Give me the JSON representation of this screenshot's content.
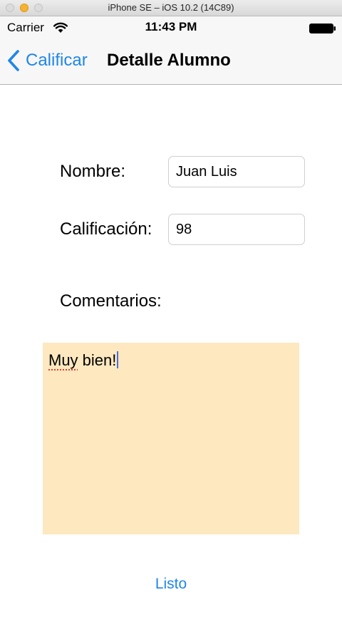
{
  "window": {
    "title": "iPhone SE – iOS 10.2 (14C89)"
  },
  "status_bar": {
    "carrier": "Carrier",
    "time": "11:43 PM",
    "wifi_icon": "wifi-icon",
    "battery_icon": "battery-full-icon"
  },
  "nav_bar": {
    "back_label": "Calificar",
    "back_icon": "chevron-left-icon",
    "title": "Detalle Alumno",
    "tint_color": "#1f86e8"
  },
  "form": {
    "name_label": "Nombre:",
    "name_value": "Juan Luis",
    "grade_label": "Calificación:",
    "grade_value": "98",
    "comments_label": "Comentarios:",
    "comments": {
      "misspelled_word": "Muy",
      "rest": " bien!",
      "background": "#fde8bf"
    }
  },
  "actions": {
    "done_label": "Listo"
  }
}
